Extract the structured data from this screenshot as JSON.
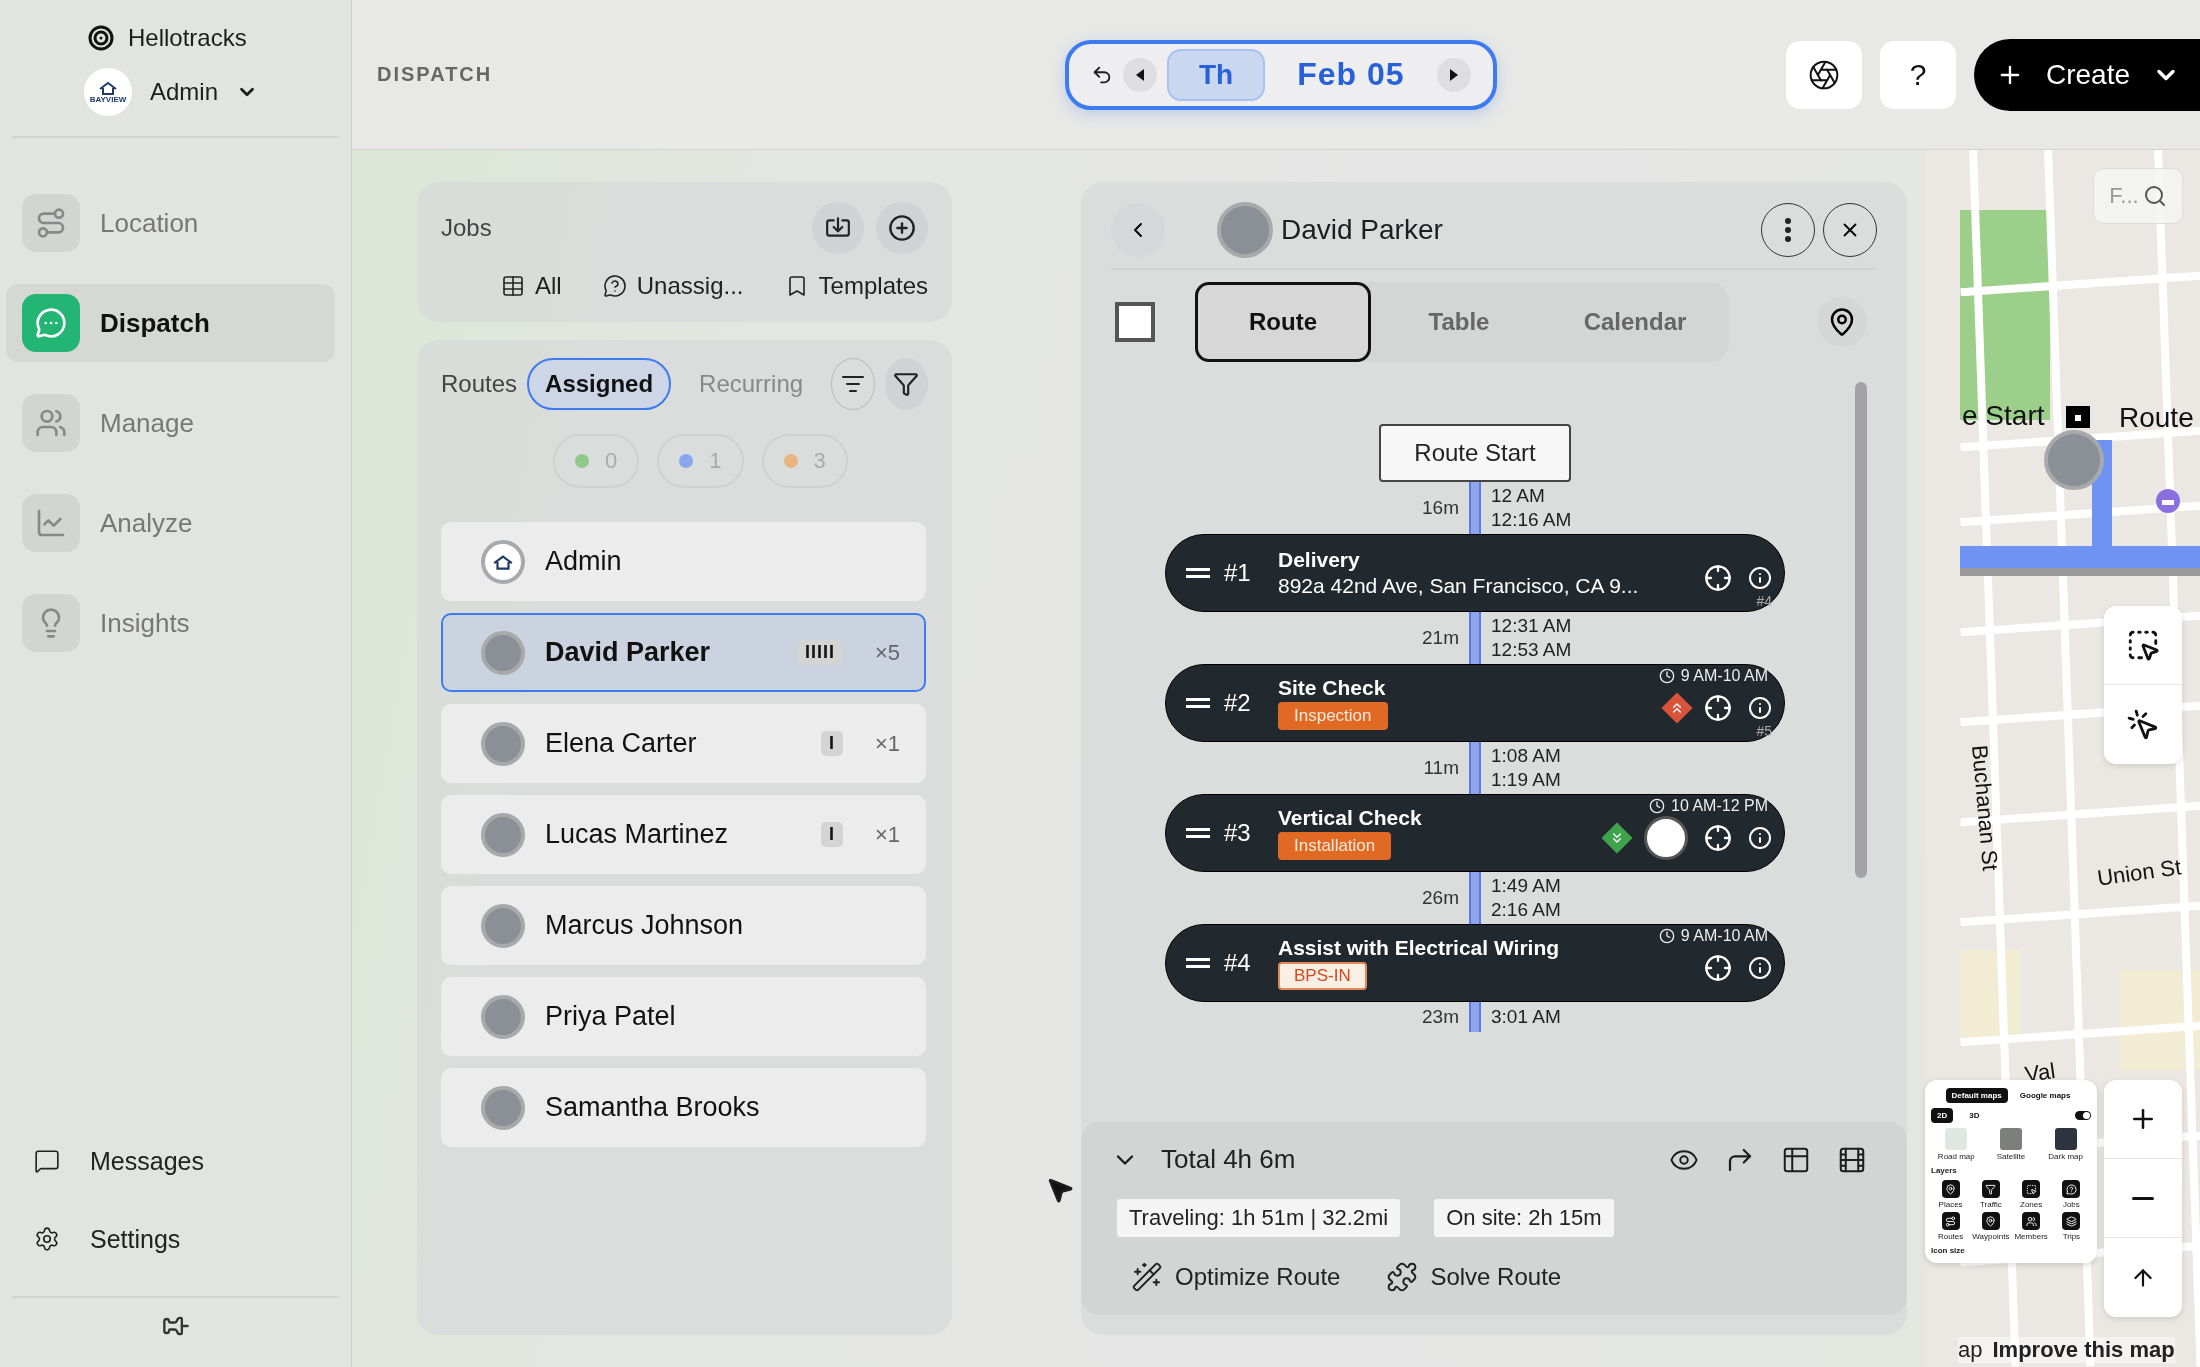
{
  "sidebar": {
    "brand": "Hellotracks",
    "account": {
      "name": "Admin",
      "logo_text": "BAYVIEW"
    },
    "nav": [
      {
        "label": "Location",
        "selected": false
      },
      {
        "label": "Dispatch",
        "selected": true
      },
      {
        "label": "Manage",
        "selected": false
      },
      {
        "label": "Analyze",
        "selected": false
      },
      {
        "label": "Insights",
        "selected": false
      }
    ],
    "bottom_nav": [
      {
        "label": "Messages"
      },
      {
        "label": "Settings"
      }
    ]
  },
  "topbar": {
    "section": "DISPATCH",
    "date": {
      "day": "Th",
      "date": "Feb 05"
    },
    "help_label": "?",
    "create_label": "Create"
  },
  "jobs_panel": {
    "title": "Jobs",
    "filters": [
      {
        "label": "All"
      },
      {
        "label": "Unassig..."
      },
      {
        "label": "Templates"
      }
    ]
  },
  "routes_panel": {
    "title": "Routes",
    "tabs": [
      {
        "label": "Assigned",
        "selected": true
      },
      {
        "label": "Recurring",
        "selected": false
      }
    ],
    "status_counts": [
      {
        "count": "0",
        "color": "#8fc98a"
      },
      {
        "count": "1",
        "color": "#8aa6ee"
      },
      {
        "count": "3",
        "color": "#e8b57f"
      }
    ],
    "members": [
      {
        "name": "Admin",
        "kind": "logo",
        "selected": false
      },
      {
        "name": "David Parker",
        "kind": "photo",
        "selected": true,
        "job_marks": "IIIII",
        "job_count": "×5"
      },
      {
        "name": "Elena Carter",
        "kind": "photo",
        "selected": false,
        "job_marks": "I",
        "job_count": "×1"
      },
      {
        "name": "Lucas Martinez",
        "kind": "photo",
        "selected": false,
        "job_marks": "I",
        "job_count": "×1"
      },
      {
        "name": "Marcus Johnson",
        "kind": "photo",
        "selected": false
      },
      {
        "name": "Priya Patel",
        "kind": "photo",
        "selected": false
      },
      {
        "name": "Samantha Brooks",
        "kind": "photo",
        "selected": false
      }
    ]
  },
  "detail": {
    "name": "David Parker",
    "select_all_checked": false,
    "view_tabs": [
      {
        "label": "Route",
        "selected": true
      },
      {
        "label": "Table",
        "selected": false
      },
      {
        "label": "Calendar",
        "selected": false
      }
    ],
    "timeline": [
      {
        "kind": "start",
        "label": "Route Start"
      },
      {
        "kind": "travel",
        "duration": "16m",
        "times": [
          "12 AM",
          "12:16 AM"
        ]
      },
      {
        "kind": "job",
        "number": "#1",
        "title": "Delivery",
        "address": "892a 42nd Ave, San Francisco, CA 9...",
        "corner": "#4"
      },
      {
        "kind": "travel",
        "duration": "21m",
        "times": [
          "12:31 AM",
          "12:53 AM"
        ]
      },
      {
        "kind": "job",
        "number": "#2",
        "title": "Site Check",
        "tag": {
          "label": "Inspection",
          "kind": "solid"
        },
        "window": "9 AM-10 AM",
        "priority_up": true,
        "corner": "#5"
      },
      {
        "kind": "travel",
        "duration": "11m",
        "times": [
          "1:08 AM",
          "1:19 AM"
        ]
      },
      {
        "kind": "job",
        "number": "#3",
        "title": "Vertical Check",
        "tag": {
          "label": "Installation",
          "kind": "solid"
        },
        "window": "10 AM-12 PM",
        "priority_down": true,
        "photo": true
      },
      {
        "kind": "travel",
        "duration": "26m",
        "times": [
          "1:49 AM",
          "2:16 AM"
        ]
      },
      {
        "kind": "job",
        "number": "#4",
        "title": "Assist with Electrical Wiring",
        "tag": {
          "label": "BPS-IN",
          "kind": "outline"
        },
        "window": "9 AM-10 AM"
      },
      {
        "kind": "travel",
        "duration": "23m",
        "times": [
          "3:01 AM"
        ]
      }
    ],
    "summary": {
      "total": "Total 4h 6m",
      "stats": [
        "Traveling: 1h 51m | 32.2mi",
        "On site: 2h 15m"
      ],
      "actions": [
        {
          "label": "Optimize Route"
        },
        {
          "label": "Solve Route"
        }
      ]
    }
  },
  "map": {
    "search_placeholder": "F...",
    "labels": [
      {
        "text": "e Start",
        "kind": "marker"
      },
      {
        "text": "Route",
        "kind": "marker"
      },
      {
        "text": "Buchanan St",
        "kind": "street-vertical"
      },
      {
        "text": "Union St",
        "kind": "street"
      },
      {
        "text": "Val",
        "kind": "street"
      }
    ],
    "attribution": [
      "ap",
      "Improve this map"
    ],
    "style_panel": {
      "tabs": [
        {
          "label": "Default maps",
          "selected": true
        },
        {
          "label": "Google maps",
          "selected": false
        }
      ],
      "modes": [
        {
          "label": "2D",
          "selected": true
        },
        {
          "label": "3D",
          "selected": false
        }
      ],
      "toggle_on": true,
      "map_types": [
        "Road map",
        "Satellite",
        "Dark map"
      ],
      "layers_title": "Layers",
      "layers": [
        "Places",
        "Traffic",
        "Zones",
        "Jobs",
        "Routes",
        "Waypoints",
        "Members",
        "Trips"
      ],
      "icon_size_label": "Icon size"
    }
  }
}
